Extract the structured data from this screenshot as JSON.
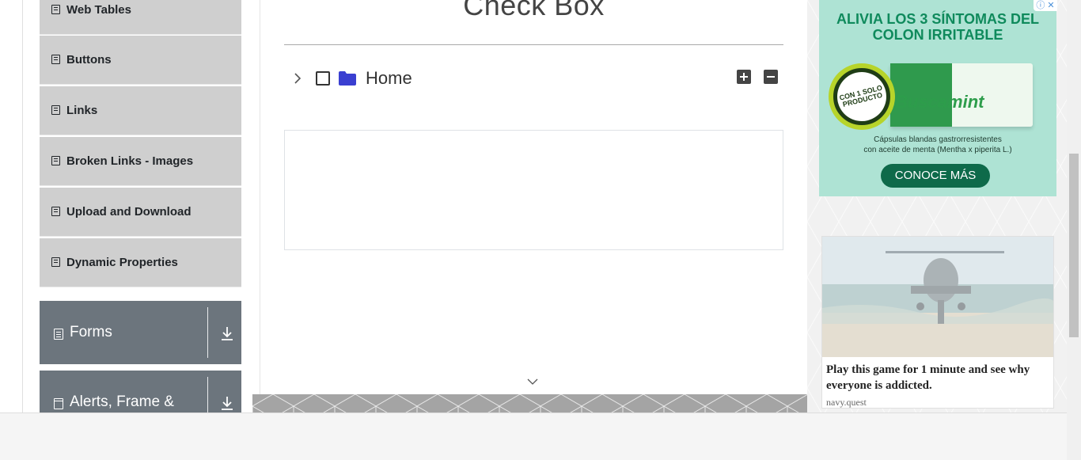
{
  "sidebar": {
    "items": [
      {
        "label": "Web Tables"
      },
      {
        "label": "Buttons"
      },
      {
        "label": "Links"
      },
      {
        "label": "Broken Links - Images"
      },
      {
        "label": "Upload and Download"
      },
      {
        "label": "Dynamic Properties"
      }
    ],
    "groups": [
      {
        "label": "Forms",
        "icon": "form-icon"
      },
      {
        "label": "Alerts, Frame &",
        "icon": "window-icon"
      }
    ]
  },
  "main": {
    "title": "Check Box",
    "tree": {
      "root_label": "Home",
      "expand_all": "+",
      "collapse_all": "−"
    }
  },
  "ads": {
    "top": {
      "headline": "ALIVIA LOS 3  SÍNTOMAS DEL COLON IRRITABLE",
      "seal": "CON 1 SOLO PRODUCTO",
      "brand": "Buscamint",
      "subtitle_1": "Cápsulas blandas gastrorresistentes",
      "subtitle_2": "con aceite de menta (Mentha x piperita L.)",
      "cta": "CONOCE MÁS",
      "adchoice": "ⓘ ✕"
    },
    "bottom": {
      "caption": "Play this game for 1 minute and see why everyone is addicted.",
      "source": "navy.quest"
    }
  },
  "colors": {
    "menu_bg": "#cfcfcf",
    "group_bg": "#6c757d",
    "folder": "#3a3fd1"
  }
}
